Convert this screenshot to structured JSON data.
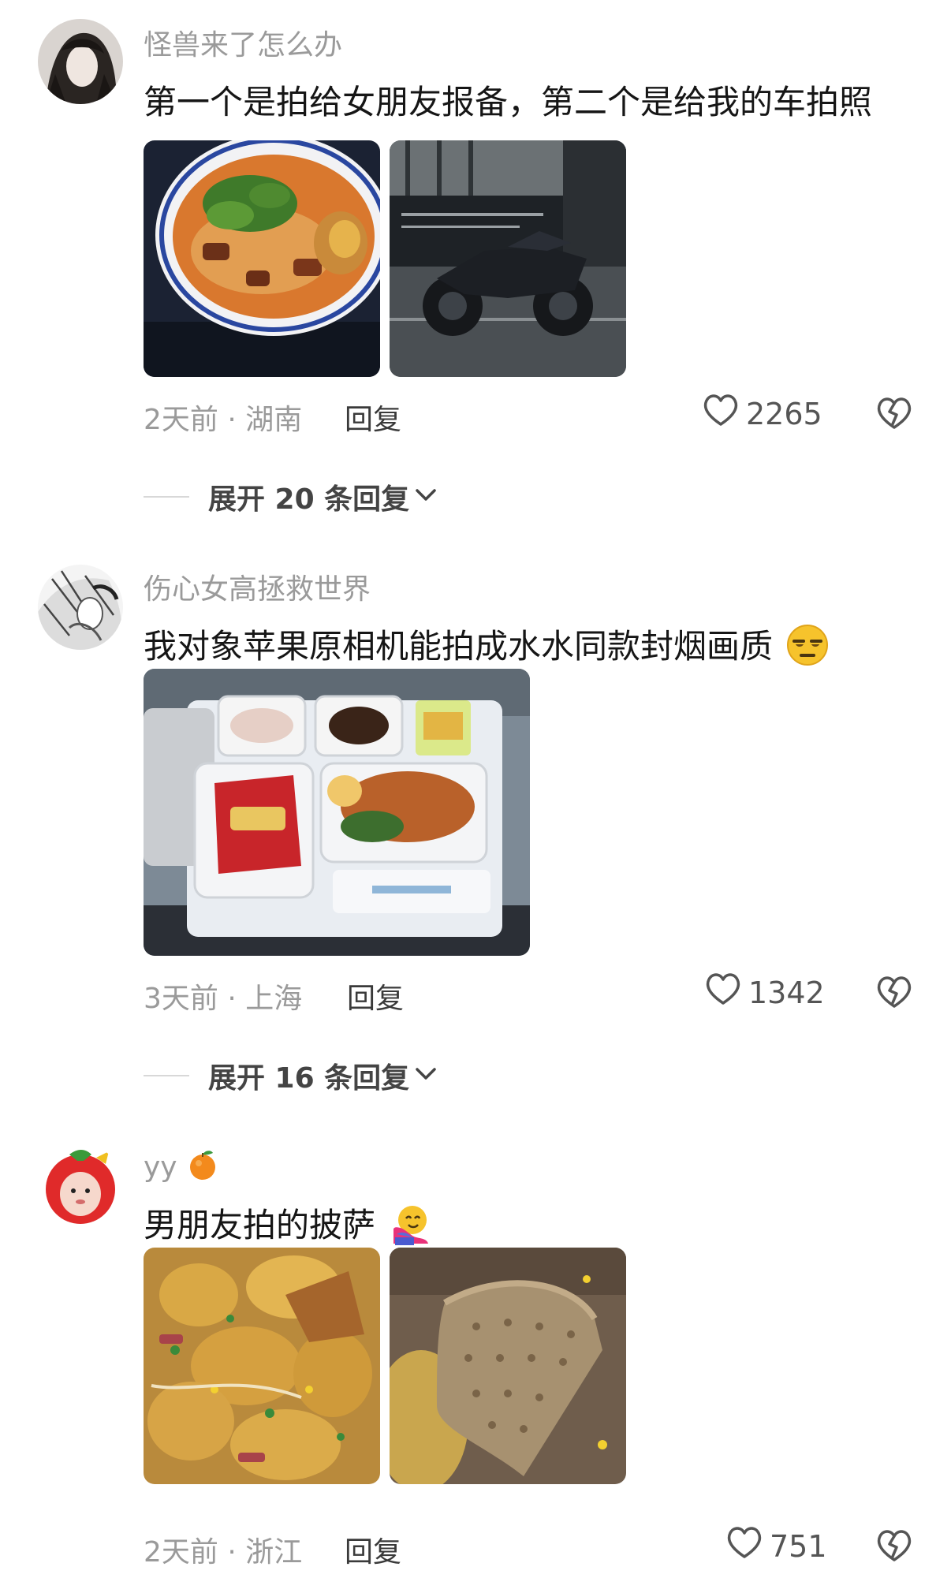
{
  "comments": [
    {
      "username": "怪兽来了怎么办",
      "text": "第一个是拍给女朋友报备，第二个是给我的车拍照",
      "photos": [
        "noodle-bowl-photo",
        "motorcycle-photo"
      ],
      "time_location": "2天前 · 湖南",
      "reply_label": "回复",
      "likes": "2265",
      "expand_label": "展开 20 条回复"
    },
    {
      "username": "伤心女高拯救世界",
      "text": "我对象苹果原相机能拍成水水同款封烟画质",
      "emoji": "😒",
      "photos": [
        "airline-meal-photo"
      ],
      "time_location": "3天前 · 上海",
      "reply_label": "回复",
      "likes": "1342",
      "expand_label": "展开 16 条回复"
    },
    {
      "username": "yy",
      "username_emoji": "🍊",
      "text": "男朋友拍的披萨",
      "emoji": "🫂",
      "photos": [
        "pizza-photo",
        "pizza-slice-photo"
      ],
      "time_location": "2天前 · 浙江",
      "reply_label": "回复",
      "likes": "751"
    }
  ],
  "icons": {
    "like": "heart-outline-icon",
    "dislike": "broken-heart-icon",
    "expand": "chevron-down-icon"
  },
  "colors": {
    "username": "#9a9a9a",
    "text": "#161616",
    "meta": "#9a9a9a"
  }
}
